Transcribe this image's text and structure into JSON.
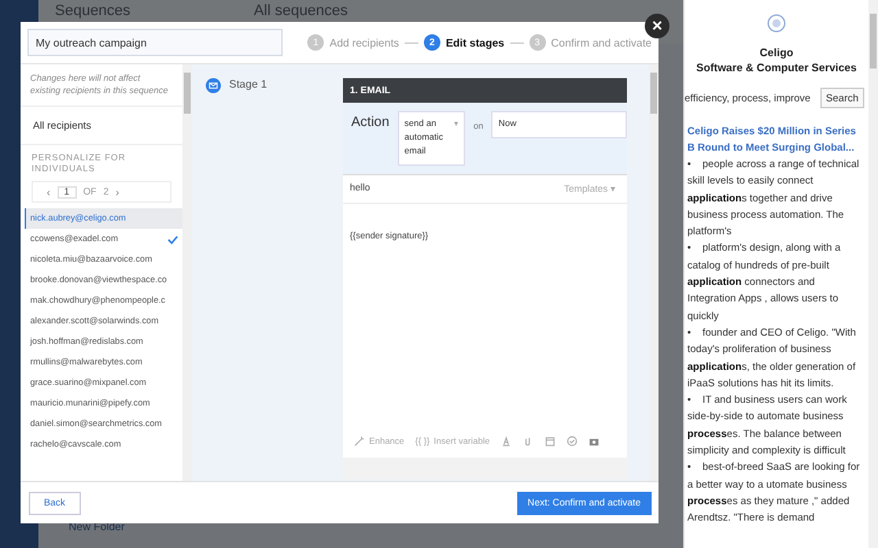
{
  "background_app": {
    "title": "Sequences",
    "subtitle": "All sequences",
    "new_folder": "New Folder"
  },
  "modal": {
    "campaign_name": "My outreach campaign",
    "steps": [
      {
        "number": "1",
        "label": "Add recipients",
        "selected": false
      },
      {
        "number": "2",
        "label": "Edit stages",
        "selected": true
      },
      {
        "number": "3",
        "label": "Confirm and activate",
        "selected": false
      }
    ],
    "note": "Changes here will not affect existing recipients in this sequence",
    "all_recipients": "All recipients",
    "personalize_heading": "PERSONALIZE FOR INDIVIDUALS",
    "pager": {
      "prev": "‹",
      "page": "1",
      "of": "OF",
      "total": "2",
      "next": "›"
    },
    "recipients": [
      {
        "email": "nick.aubrey@celigo.com",
        "selected": true,
        "checked": false
      },
      {
        "email": "ccowens@exadel.com",
        "selected": false,
        "checked": true
      },
      {
        "email": "nicoleta.miu@bazaarvoice.com",
        "selected": false,
        "checked": false
      },
      {
        "email": "brooke.donovan@viewthespace.co",
        "selected": false,
        "checked": false
      },
      {
        "email": "mak.chowdhury@phenompeople.c",
        "selected": false,
        "checked": false
      },
      {
        "email": "alexander.scott@solarwinds.com",
        "selected": false,
        "checked": false
      },
      {
        "email": "josh.hoffman@redislabs.com",
        "selected": false,
        "checked": false
      },
      {
        "email": "rmullins@malwarebytes.com",
        "selected": false,
        "checked": false
      },
      {
        "email": "grace.suarino@mixpanel.com",
        "selected": false,
        "checked": false
      },
      {
        "email": "mauricio.munarini@pipefy.com",
        "selected": false,
        "checked": false
      },
      {
        "email": "daniel.simon@searchmetrics.com",
        "selected": false,
        "checked": false
      },
      {
        "email": "rachelo@cavscale.com",
        "selected": false,
        "checked": false
      }
    ],
    "stage": "Stage 1",
    "email_card": {
      "header": "1. EMAIL",
      "action_label": "Action",
      "action_value": "send an automatic email",
      "action_caret": "▾",
      "on_label": "on",
      "timing_value": "Now",
      "subject": "hello",
      "templates": "Templates",
      "templates_caret": "▾",
      "body": "{{sender signature}}",
      "enhance": "Enhance",
      "insert_variable_icon": "{{ }}",
      "insert_variable": "Insert variable"
    },
    "back": "Back",
    "next": "Next: Confirm and activate",
    "close": "×"
  },
  "side_panel": {
    "company": "Celigo",
    "category": "Software & Computer Services",
    "search_value": "efficiency, process, improve",
    "search_button": "Search",
    "article_title": "Celigo Raises $20 Million in Series B Round to Meet Surging Global...",
    "bullets": [
      {
        "marker": "•",
        "text": "people across a range of technical skill levels to easily connect **application**s together and drive business process automation. The platform's"
      },
      {
        "marker": "•",
        "text": "platform's design, along with a catalog of hundreds of pre-built **application** connectors and Integration Apps , allows users to quickly"
      },
      {
        "marker": "•",
        "text": "founder and CEO of Celigo. \"With today's proliferation of business **application**s, the older generation of iPaaS solutions has hit its limits."
      },
      {
        "marker": "•",
        "text": "IT and business users can work side-by-side to automate business **process**es. The balance between simplicity and complexity is difficult"
      },
      {
        "marker": "•",
        "text": "best-of-breed SaaS are looking for a better way to a utomate business **process**es as they mature ,\" added Arendtsz. \"There is demand"
      }
    ]
  }
}
